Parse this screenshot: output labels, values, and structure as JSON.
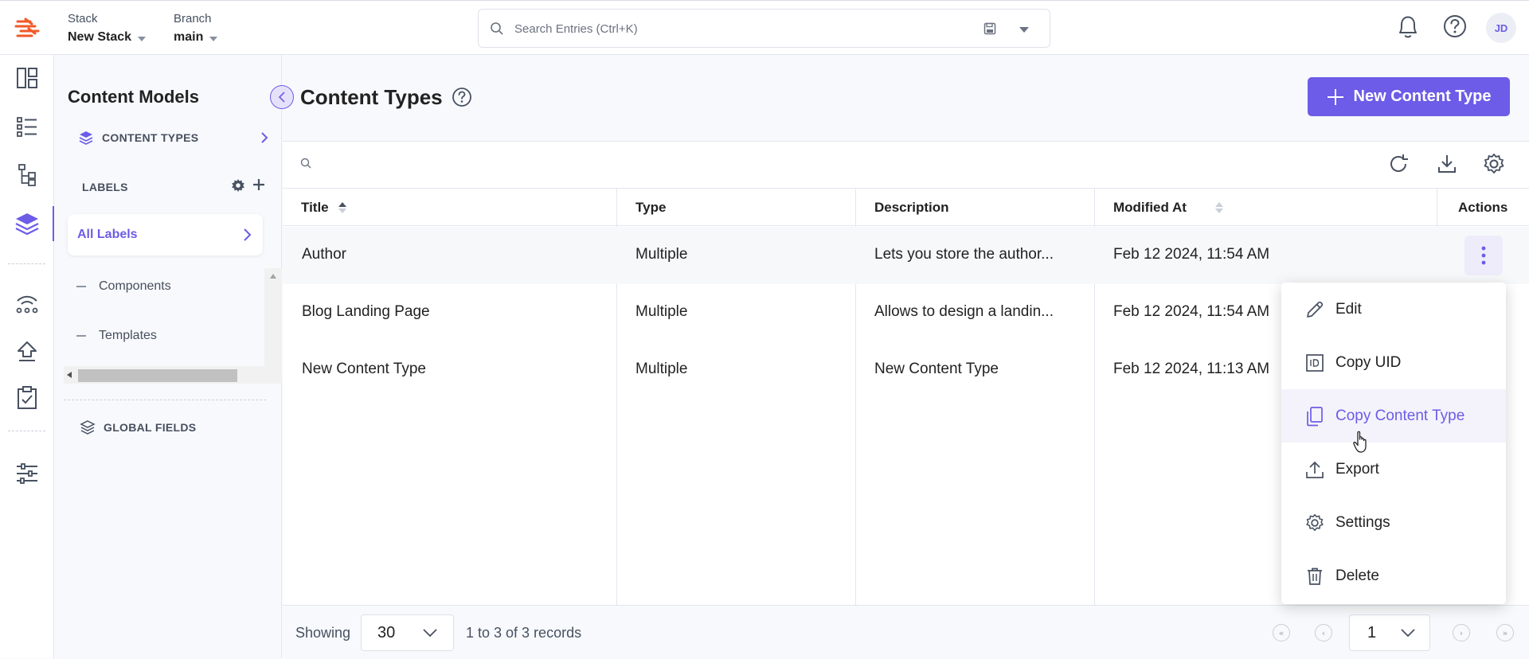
{
  "topbar": {
    "stack_label": "Stack",
    "stack_value": "New Stack",
    "branch_label": "Branch",
    "branch_value": "main",
    "search_placeholder": "Search Entries (Ctrl+K)",
    "avatar_initials": "JD"
  },
  "panel": {
    "title": "Content Models",
    "content_types": "CONTENT TYPES",
    "labels_heading": "LABELS",
    "all_labels": "All Labels",
    "labels": [
      "Components",
      "Templates"
    ],
    "global_fields": "GLOBAL FIELDS"
  },
  "main": {
    "title": "Content Types",
    "new_button": "New Content Type",
    "columns": [
      "Title",
      "Type",
      "Description",
      "Modified At",
      "Actions"
    ],
    "rows": [
      {
        "title": "Author",
        "type": "Multiple",
        "description": "Lets you store the author...",
        "modified": "Feb 12 2024, 11:54 AM"
      },
      {
        "title": "Blog Landing Page",
        "type": "Multiple",
        "description": "Allows to design a landin...",
        "modified": "Feb 12 2024, 11:54 AM"
      },
      {
        "title": "New Content Type",
        "type": "Multiple",
        "description": "New Content Type",
        "modified": "Feb 12 2024, 11:13 AM"
      }
    ],
    "footer": {
      "showing_label": "Showing",
      "page_size": "30",
      "records": "1 to 3 of 3 records",
      "page": "1"
    }
  },
  "actions_menu": {
    "items": [
      "Edit",
      "Copy UID",
      "Copy Content Type",
      "Export",
      "Settings",
      "Delete"
    ],
    "hovered": "Copy Content Type"
  },
  "colors": {
    "accent": "#6c5ce7",
    "brand": "#f15a29"
  }
}
